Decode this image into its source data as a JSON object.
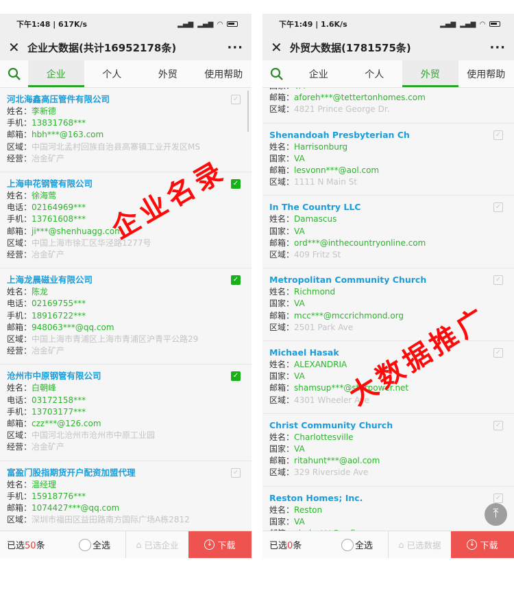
{
  "colors": {
    "accent": "#2aa52a",
    "title": "#1a9ddb",
    "download": "#ef5350",
    "watermark": "#ff0a0a"
  },
  "screens": [
    {
      "status": {
        "time": "下午1:48 | 617K/s"
      },
      "title": "企业大数据(共计16952178条)",
      "more": "···",
      "tabs": [
        {
          "label": "企业",
          "active": true
        },
        {
          "label": "个人"
        },
        {
          "label": "外贸"
        },
        {
          "label": "使用帮助"
        }
      ],
      "watermark": "企业名录",
      "cards": [
        {
          "title": "河北海鑫高压管件有限公司",
          "checked": false,
          "rows": [
            [
              "姓名：",
              "李新德",
              "g"
            ],
            [
              "手机：",
              "13831768***",
              "g"
            ],
            [
              "邮箱：",
              "hbh***@163.com",
              "g"
            ],
            [
              "区域：",
              "中国河北孟村回族自治县高寨镇工业开发区MS",
              "x"
            ],
            [
              "经营：",
              "冶金矿产",
              "x"
            ]
          ]
        },
        {
          "title": "上海申花钢管有限公司",
          "checked": true,
          "rows": [
            [
              "姓名：",
              "徐海莺",
              "g"
            ],
            [
              "电话：",
              "02164969***",
              "g"
            ],
            [
              "手机：",
              "13761608***",
              "g"
            ],
            [
              "邮箱：",
              "ji***@shenhuagg.com",
              "g"
            ],
            [
              "区域：",
              "中国上海市徐汇区华泾路1277号",
              "x"
            ],
            [
              "经营：",
              "冶金矿产",
              "x"
            ]
          ]
        },
        {
          "title": "上海龙晨磁业有限公司",
          "checked": true,
          "rows": [
            [
              "姓名：",
              "陈龙",
              "g"
            ],
            [
              "电话：",
              "02169755***",
              "g"
            ],
            [
              "手机：",
              "18916722***",
              "g"
            ],
            [
              "邮箱：",
              "948063***@qq.com",
              "g"
            ],
            [
              "区域：",
              "中国上海市青浦区上海市青浦区沪青平公路29",
              "x"
            ],
            [
              "经营：",
              "冶金矿产",
              "x"
            ]
          ]
        },
        {
          "title": "沧州市中原钢管有限公司",
          "checked": true,
          "rows": [
            [
              "姓名：",
              "白朝峰",
              "g"
            ],
            [
              "电话：",
              "03172158***",
              "g"
            ],
            [
              "手机：",
              "13703177***",
              "g"
            ],
            [
              "邮箱：",
              "czz***@126.com",
              "g"
            ],
            [
              "区域：",
              "中国河北沧州市沧州市中原工业园",
              "x"
            ],
            [
              "经营：",
              "冶金矿产",
              "x"
            ]
          ]
        },
        {
          "title": "富盈门股指期货开户配资加盟代理",
          "checked": false,
          "rows": [
            [
              "姓名：",
              "温经理",
              "g"
            ],
            [
              "手机：",
              "15918776***",
              "g"
            ],
            [
              "邮箱：",
              "1074427***@qq.com",
              "g"
            ],
            [
              "区域：",
              "深圳市福田区益田路南方国际广场A栋2812",
              "x"
            ]
          ]
        }
      ],
      "bottom": {
        "prefix": "已选",
        "count": "50",
        "suffix": "条",
        "select_all": "全选",
        "selected": "已选企业",
        "download": "下载"
      }
    },
    {
      "status": {
        "time": "下午1:49 | 1.6K/s"
      },
      "title": "外贸大数据(1781575条)",
      "more": "···",
      "tabs": [
        {
          "label": "企业"
        },
        {
          "label": "个人"
        },
        {
          "label": "外贸",
          "active": true
        },
        {
          "label": "使用帮助"
        }
      ],
      "watermark": "大数据推广",
      "cards": [
        {
          "partial": true,
          "rows": [
            [
              "国家：",
              "VA",
              "g"
            ],
            [
              "邮箱：",
              "aforeh***@tettertonhomes.com",
              "g"
            ],
            [
              "区域：",
              "4821 Prince George Dr.",
              "x"
            ]
          ]
        },
        {
          "title": "Shenandoah Presbyterian Ch",
          "checked": false,
          "rows": [
            [
              "姓名：",
              "Harrisonburg",
              "g"
            ],
            [
              "国家：",
              "VA",
              "g"
            ],
            [
              "邮箱：",
              "lesvonn***@aol.com",
              "g"
            ],
            [
              "区域：",
              "1111 N Main St",
              "x"
            ]
          ]
        },
        {
          "title": "In The Country LLC",
          "checked": false,
          "rows": [
            [
              "姓名：",
              "Damascus",
              "g"
            ],
            [
              "国家：",
              "VA",
              "g"
            ],
            [
              "邮箱：",
              "ord***@inthecountryonline.com",
              "g"
            ],
            [
              "区域：",
              "409 Fritz St",
              "x"
            ]
          ]
        },
        {
          "title": "Metropolitan Community Church",
          "checked": false,
          "rows": [
            [
              "姓名：",
              "Richmond",
              "g"
            ],
            [
              "国家：",
              "VA",
              "g"
            ],
            [
              "邮箱：",
              "mcc***@mccrichmond.org",
              "g"
            ],
            [
              "区域：",
              "2501 Park Ave",
              "x"
            ]
          ]
        },
        {
          "title": "Michael Hasak",
          "checked": false,
          "rows": [
            [
              "姓名：",
              "ALEXANDRIA",
              "g"
            ],
            [
              "国家：",
              "VA",
              "g"
            ],
            [
              "邮箱：",
              "shamsup***@starpower.net",
              "g"
            ],
            [
              "区域：",
              "4301 Wheeler Ave",
              "x"
            ]
          ]
        },
        {
          "title": "Christ Community Church",
          "checked": false,
          "rows": [
            [
              "姓名：",
              "Charlottesville",
              "g"
            ],
            [
              "国家：",
              "VA",
              "g"
            ],
            [
              "邮箱：",
              "ritahunt***@aol.com",
              "g"
            ],
            [
              "区域：",
              "329 Riverside Ave",
              "x"
            ]
          ]
        },
        {
          "title": "Reston Homes; Inc.",
          "checked": false,
          "rows": [
            [
              "姓名：",
              "Reston",
              "g"
            ],
            [
              "国家：",
              "VA",
              "g"
            ],
            [
              "邮箱：",
              "cindyr***@nvfh.com",
              "g"
            ]
          ]
        }
      ],
      "bottom": {
        "prefix": "已选",
        "count": "0",
        "suffix": "条",
        "select_all": "全选",
        "selected": "已选数据",
        "download": "下载"
      }
    }
  ]
}
